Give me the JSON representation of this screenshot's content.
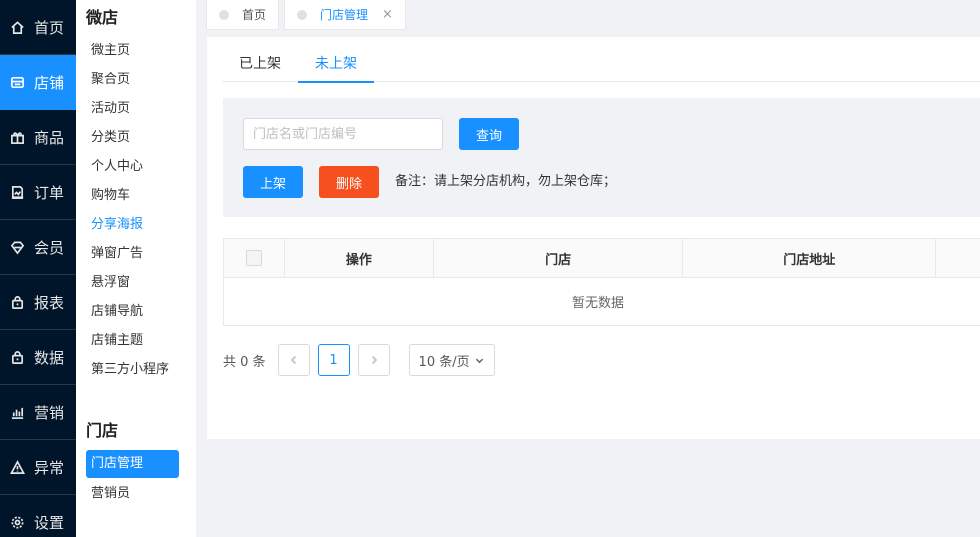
{
  "nav": {
    "items": [
      {
        "label": "首页",
        "icon": "home-icon"
      },
      {
        "label": "店铺",
        "icon": "store-icon"
      },
      {
        "label": "商品",
        "icon": "gift-icon"
      },
      {
        "label": "订单",
        "icon": "order-icon"
      },
      {
        "label": "会员",
        "icon": "diamond-icon"
      },
      {
        "label": "报表",
        "icon": "bag-icon"
      },
      {
        "label": "数据",
        "icon": "bag-icon"
      },
      {
        "label": "营销",
        "icon": "bar-chart-icon"
      },
      {
        "label": "异常",
        "icon": "warning-icon"
      },
      {
        "label": "设置",
        "icon": "gear-icon"
      }
    ],
    "active_index": 1,
    "accent": "#1890ff",
    "background": "#001529"
  },
  "submenu": {
    "sections": [
      {
        "title": "微店",
        "items": [
          "微主页",
          "聚合页",
          "活动页",
          "分类页",
          "个人中心",
          "购物车",
          "分享海报",
          "弹窗广告",
          "悬浮窗",
          "店铺导航",
          "店铺主题",
          "第三方小程序"
        ]
      },
      {
        "title": "门店",
        "items": [
          "门店管理",
          "营销员"
        ]
      }
    ],
    "highlighted_item": "分享海报",
    "active_item": "门店管理"
  },
  "page_tabs": [
    {
      "label": "首页"
    },
    {
      "label": "门店管理",
      "closable": true,
      "close_glyph": "×"
    }
  ],
  "tabs": {
    "items": [
      "已上架",
      "未上架"
    ],
    "active_index": 1
  },
  "filter": {
    "search_placeholder": "门店名或门店编号",
    "search_value": "",
    "query_button": "查询",
    "shelve_button": "上架",
    "delete_button": "删除",
    "note": "备注：请上架分店机构，勿上架仓库；",
    "danger_color": "#f5501e"
  },
  "table": {
    "columns": [
      "操作",
      "门店",
      "门店地址"
    ],
    "rows": [],
    "empty_text": "暂无数据"
  },
  "pagination": {
    "total_text": "共 0 条",
    "current_page": "1",
    "page_size": "10 条/页"
  }
}
